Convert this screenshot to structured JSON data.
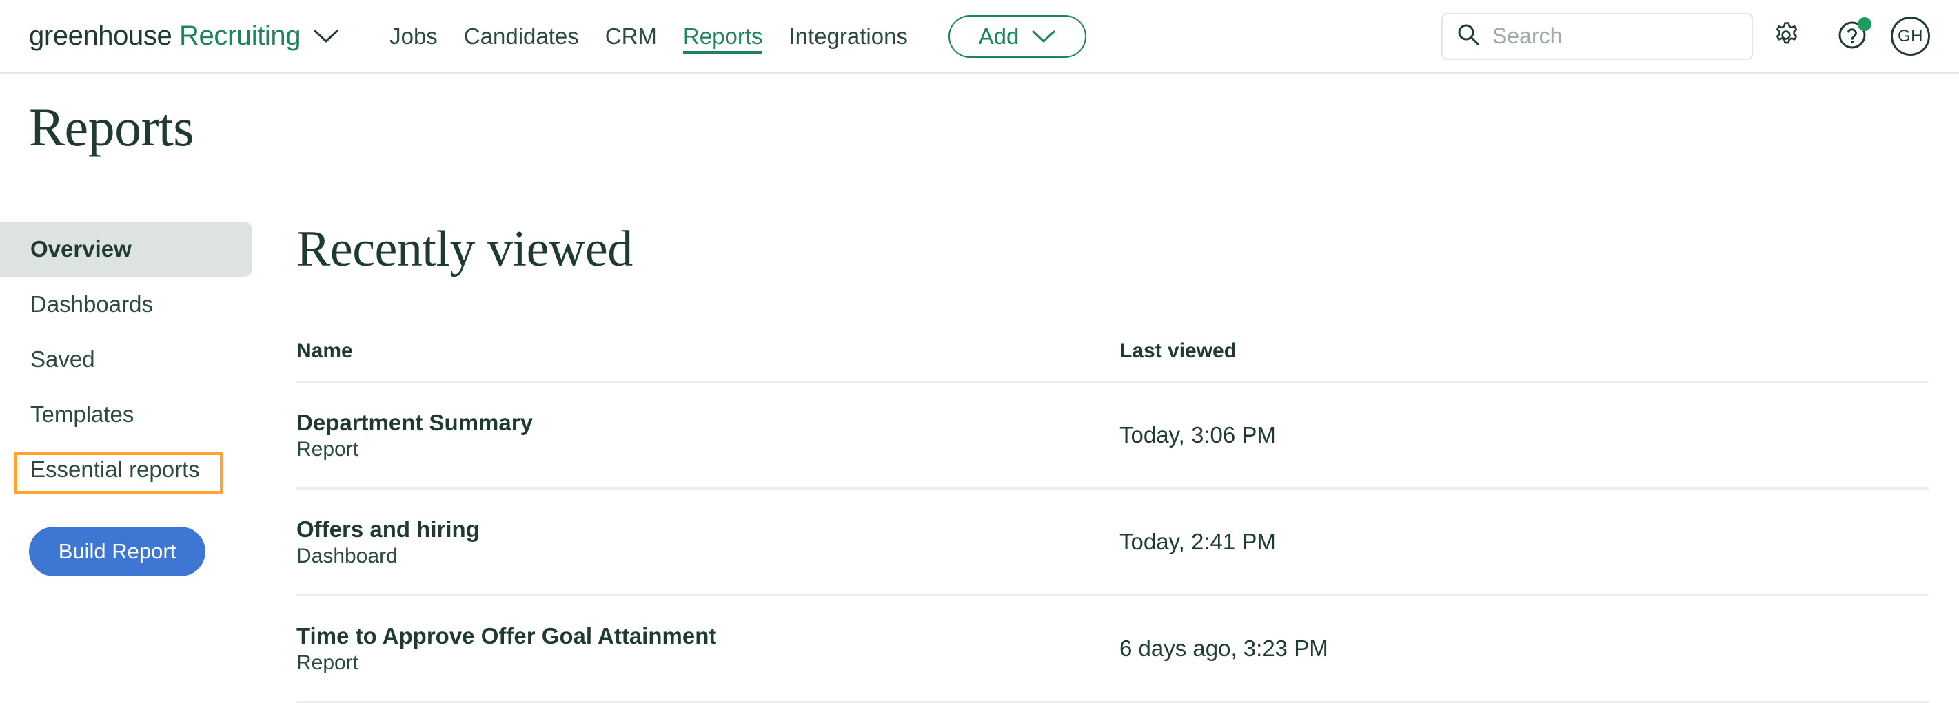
{
  "brand": {
    "name_dark": "greenhouse",
    "name_green": " Recruiting",
    "caret_icon": "chevron-down-icon"
  },
  "colors": {
    "brand_green": "#1d855c",
    "dark_green": "#1f3b30",
    "accent_blue": "#3e76d3",
    "annotation_orange": "#ffa333",
    "active_sidebar_bg": "#dce3e0",
    "notification_green": "#1d9b63"
  },
  "topnav": {
    "links": [
      {
        "label": "Jobs",
        "active": false
      },
      {
        "label": "Candidates",
        "active": false
      },
      {
        "label": "CRM",
        "active": false
      },
      {
        "label": "Reports",
        "active": true
      },
      {
        "label": "Integrations",
        "active": false
      }
    ],
    "add_button": {
      "label": "Add",
      "icon": "chevron-down-icon"
    },
    "search": {
      "placeholder": "Search",
      "value": "",
      "icon": "search-icon"
    },
    "settings_icon": "gear-icon",
    "help_icon": "question-mark-circle-icon",
    "help_has_notification": true,
    "avatar_initials": "GH"
  },
  "page": {
    "title": "Reports"
  },
  "sidebar": {
    "items": [
      {
        "label": "Overview",
        "active": true,
        "annotated": false
      },
      {
        "label": "Dashboards",
        "active": false,
        "annotated": false
      },
      {
        "label": "Saved",
        "active": false,
        "annotated": false
      },
      {
        "label": "Templates",
        "active": false,
        "annotated": false
      },
      {
        "label": "Essential reports",
        "active": false,
        "annotated": true
      }
    ],
    "build_button_label": "Build Report"
  },
  "main": {
    "section_title": "Recently viewed",
    "table": {
      "columns": [
        "Name",
        "Last viewed"
      ],
      "rows": [
        {
          "name": "Department Summary",
          "type": "Report",
          "last_viewed": "Today, 3:06 PM"
        },
        {
          "name": "Offers and hiring",
          "type": "Dashboard",
          "last_viewed": "Today, 2:41 PM"
        },
        {
          "name": "Time to Approve Offer Goal Attainment",
          "type": "Report",
          "last_viewed": "6 days ago, 3:23 PM"
        }
      ]
    }
  }
}
